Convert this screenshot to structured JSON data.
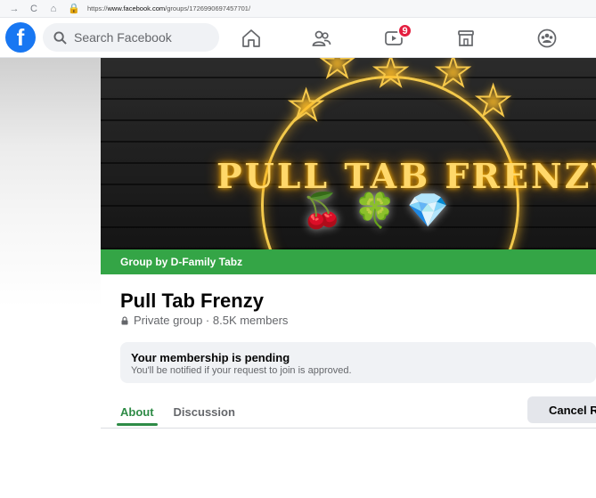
{
  "browser": {
    "url_prefix": "https://",
    "url_host": "www.facebook.com",
    "url_path": "/groups/1726990697457701/"
  },
  "topbar": {
    "logo_letter": "f",
    "search_placeholder": "Search Facebook",
    "watch_badge": "9"
  },
  "cover": {
    "neon_title": "PULL TAB FRENZY",
    "icons": [
      "cherries",
      "lucky-clover",
      "diamond"
    ]
  },
  "group": {
    "by_label": "Group by D-Family Tabz",
    "name": "Pull Tab Frenzy",
    "meta": "Private group · 8.5K members"
  },
  "pending": {
    "heading": "Your membership is pending",
    "subtext": "You'll be notified if your request to join is approved."
  },
  "tabs": [
    {
      "label": "About",
      "active": true
    },
    {
      "label": "Discussion",
      "active": false
    }
  ],
  "cancel_button": "Cancel Request",
  "colors": {
    "facebook_blue": "#1877f2",
    "group_green": "#34a546",
    "tab_active": "#2e8b46",
    "badge_red": "#e41e3f"
  }
}
